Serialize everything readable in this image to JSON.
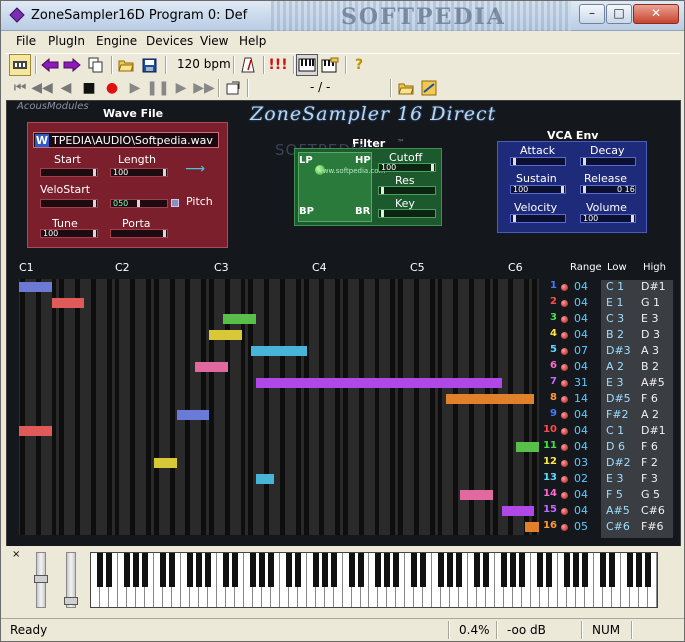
{
  "window": {
    "title": "ZoneSampler16D Program 0: Def",
    "watermark": "SOFTPEDIA",
    "controls": {
      "minimize": "–",
      "maximize": "□",
      "close": "✕"
    }
  },
  "menu": [
    "File",
    "PlugIn",
    "Engine",
    "Devices",
    "View",
    "Help"
  ],
  "toolbar": {
    "bpm": "120 bpm",
    "position": "- / -",
    "icons": [
      "plugin-icon",
      "arrow-left-icon",
      "arrow-right-icon",
      "copy-icon",
      "open-folder-icon",
      "save-disk-icon",
      "metronome-icon",
      "panic-icon",
      "keyboard-icon",
      "keyboard-edit-icon",
      "help-icon"
    ],
    "panic": "!!!",
    "help": "?"
  },
  "panel": {
    "brand": "AcousModules",
    "title": "ZoneSampler 16 Direct",
    "tm": "™",
    "watermark": "SOFTPEDIA",
    "watermark2": "www.softpedia.com",
    "wave": {
      "title": "Wave File",
      "badge": "W",
      "path": "TPEDIA\\AUDIO\\Softpedia.wav",
      "start_label": "Start",
      "length_label": "Length",
      "velostart_label": "VeloStart",
      "pitch_label": "Pitch",
      "tune_label": "Tune",
      "porta_label": "Porta",
      "start_val": "",
      "length_val": "100",
      "velostart_val": "",
      "pitch_val": "050",
      "tune_val": "100",
      "porta_val": "",
      "arrow": "⟶"
    },
    "filter": {
      "title": "Filter",
      "lp": "LP",
      "hp": "HP",
      "bp": "BP",
      "br": "BR",
      "cutoff_label": "Cutoff",
      "res_label": "Res",
      "key_label": "Key",
      "cutoff_val": "100",
      "res_val": "",
      "key_val": ""
    },
    "vca": {
      "title": "VCA Env",
      "attack_label": "Attack",
      "decay_label": "Decay",
      "sustain_label": "Sustain",
      "release_label": "Release",
      "velocity_label": "Velocity",
      "volume_label": "Volume",
      "attack_val": "",
      "decay_val": "",
      "sustain_val": "100",
      "release_val": "0 16",
      "velocity_val": "",
      "volume_val": "100"
    }
  },
  "octaves": [
    "C1",
    "C2",
    "C3",
    "C4",
    "C5",
    "C6"
  ],
  "zone_header": {
    "range": "Range",
    "low": "Low",
    "high": "High"
  },
  "zones": [
    {
      "num": "1",
      "range": "04",
      "low": "C 1",
      "high": "D#1",
      "color": "#6c7ad6",
      "bar": [
        0,
        7
      ]
    },
    {
      "num": "2",
      "range": "04",
      "low": "E 1",
      "high": "G 1",
      "color": "#e05a5a",
      "bar": [
        7,
        14
      ]
    },
    {
      "num": "3",
      "range": "04",
      "low": "C 3",
      "high": "E 3",
      "color": "#58c04a",
      "bar": [
        44,
        51
      ]
    },
    {
      "num": "4",
      "range": "04",
      "low": "B 2",
      "high": "D 3",
      "color": "#d8c838",
      "bar": [
        41,
        48
      ]
    },
    {
      "num": "5",
      "range": "07",
      "low": "D#3",
      "high": "A 3",
      "color": "#47b5d8",
      "bar": [
        50,
        62
      ]
    },
    {
      "num": "6",
      "range": "04",
      "low": "A 2",
      "high": "B 2",
      "color": "#e06aa0",
      "bar": [
        38,
        45
      ]
    },
    {
      "num": "7",
      "range": "31",
      "low": "E 3",
      "high": "A#5",
      "color": "#b048e8",
      "bar": [
        51,
        104
      ]
    },
    {
      "num": "8",
      "range": "14",
      "low": "D#5",
      "high": "F 6",
      "color": "#e0802a",
      "bar": [
        92,
        111
      ]
    },
    {
      "num": "9",
      "range": "04",
      "low": "F#2",
      "high": "A 2",
      "color": "#6a7ad8",
      "bar": [
        34,
        41
      ]
    },
    {
      "num": "10",
      "range": "04",
      "low": "C 1",
      "high": "D#1",
      "color": "#e05a5a",
      "bar": [
        0,
        7
      ]
    },
    {
      "num": "11",
      "range": "04",
      "low": "D 6",
      "high": "F 6",
      "color": "#58c04a",
      "bar": [
        107,
        112
      ]
    },
    {
      "num": "12",
      "range": "03",
      "low": "D#2",
      "high": "F 2",
      "color": "#d8c838",
      "bar": [
        29,
        34
      ]
    },
    {
      "num": "13",
      "range": "02",
      "low": "E 3",
      "high": "F 3",
      "color": "#47b5d8",
      "bar": [
        51,
        55
      ]
    },
    {
      "num": "14",
      "range": "04",
      "low": "F 5",
      "high": "G 5",
      "color": "#e06aa0",
      "bar": [
        95,
        102
      ]
    },
    {
      "num": "15",
      "range": "04",
      "low": "A#5",
      "high": "C#6",
      "color": "#b048e8",
      "bar": [
        104,
        111
      ]
    },
    {
      "num": "16",
      "range": "05",
      "low": "C#6",
      "high": "F#6",
      "color": "#e0802a",
      "bar": [
        109,
        112
      ]
    }
  ],
  "zone_num_colors": [
    "#4a78ff",
    "#ff4a4a",
    "#4adf4a",
    "#ffe84a",
    "#5fd8ff",
    "#ff6ad0",
    "#c46aff",
    "#ff9a3a",
    "#4a78ff",
    "#ff4a4a",
    "#4adf4a",
    "#ffe84a",
    "#5fd8ff",
    "#ff6ad0",
    "#c46aff",
    "#ff9a3a"
  ],
  "keyboard": {
    "close": "×"
  },
  "status": {
    "ready": "Ready",
    "cpu": "0.4%",
    "level": "-oo dB",
    "num": "NUM"
  }
}
